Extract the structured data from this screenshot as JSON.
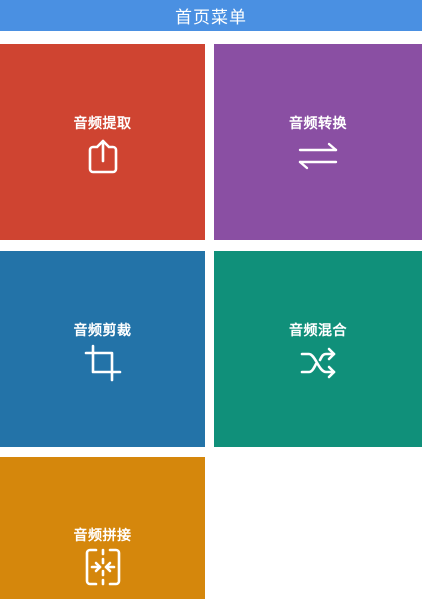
{
  "header": {
    "title": "首页菜单",
    "background": "#4a90e2"
  },
  "menu": {
    "items": [
      {
        "id": "extract",
        "label": "音频提取",
        "icon": "share-upload-icon",
        "color": "#cf4431"
      },
      {
        "id": "convert",
        "label": "音频转换",
        "icon": "swap-arrows-icon",
        "color": "#8a4fa3"
      },
      {
        "id": "cut",
        "label": "音频剪裁",
        "icon": "crop-icon",
        "color": "#2373a8"
      },
      {
        "id": "mix",
        "label": "音频混合",
        "icon": "shuffle-icon",
        "color": "#10907a"
      },
      {
        "id": "join",
        "label": "音频拼接",
        "icon": "merge-icon",
        "color": "#d5870c"
      }
    ]
  }
}
